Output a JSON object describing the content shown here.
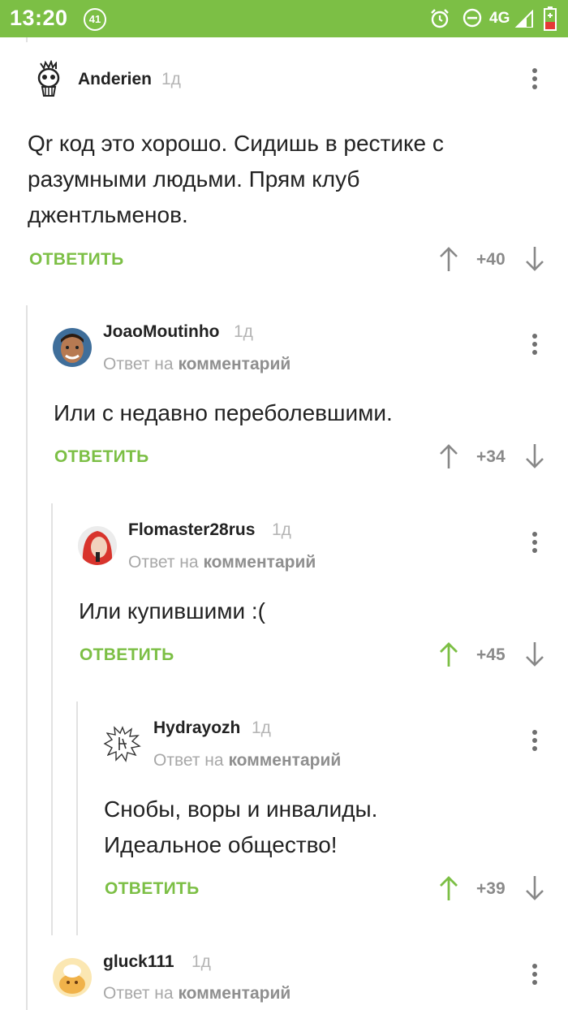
{
  "status_bar": {
    "time": "13:20",
    "notification_count": "41",
    "network": "4G"
  },
  "accent_color": "#7cbf45",
  "comments": [
    {
      "author": "Anderien",
      "age": "1д",
      "reply_to": null,
      "text": "Qr код это хорошо. Сидишь в рестике с разумными людьми. Прям клуб джентльменов.",
      "reply_label": "ОТВЕТИТЬ",
      "score": "+40",
      "upvoted": false,
      "avatar_icon": "skull-icon"
    },
    {
      "author": "JoaoMoutinho",
      "age": "1д",
      "reply_to_prefix": "Ответ на",
      "reply_to_target": "комментарий",
      "text": "Или с недавно переболевшими.",
      "reply_label": "ОТВЕТИТЬ",
      "score": "+34",
      "upvoted": false,
      "avatar_icon": "face-photo-icon"
    },
    {
      "author": "Flomaster28rus",
      "age": "1д",
      "reply_to_prefix": "Ответ на",
      "reply_to_target": "комментарий",
      "text": "Или купившими :(",
      "reply_label": "ОТВЕТИТЬ",
      "score": "+45",
      "upvoted": true,
      "avatar_icon": "red-hair-photo-icon"
    },
    {
      "author": "Hydrayozh",
      "age": "1д",
      "reply_to_prefix": "Ответ на",
      "reply_to_target": "комментарий",
      "text": "Снобы, воры и инвалиды. Идеальное общество!",
      "reply_label": "ОТВЕТИТЬ",
      "score": "+39",
      "upvoted": true,
      "avatar_icon": "sketch-drawing-icon"
    },
    {
      "author": "gluck111",
      "age": "1д",
      "reply_to_prefix": "Ответ на",
      "reply_to_target": "комментарий",
      "avatar_icon": "cartoon-avatar-icon"
    }
  ]
}
